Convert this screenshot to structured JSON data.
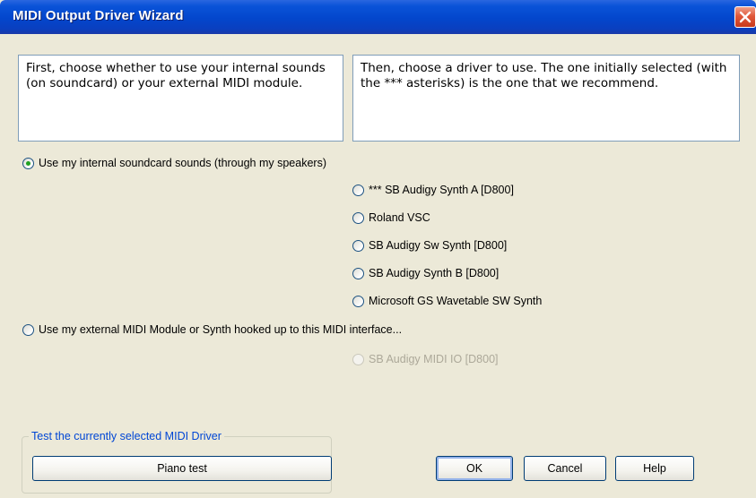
{
  "window": {
    "title": "MIDI Output Driver Wizard"
  },
  "instructions": {
    "left": "First, choose whether to use your internal sounds (on soundcard) or your external MIDI module.",
    "right": "Then, choose a driver to use. The one initially selected (with the *** asterisks) is the one that we recommend."
  },
  "options": {
    "internal_label": "Use my internal soundcard sounds (through my speakers)",
    "internal_checked": true,
    "internal_drivers": [
      "*** SB Audigy Synth A [D800]",
      "Roland VSC",
      "SB Audigy Sw Synth [D800]",
      "SB Audigy Synth B [D800]",
      "Microsoft GS Wavetable SW Synth"
    ],
    "external_label": "Use my external MIDI Module or Synth hooked up to this MIDI interface...",
    "external_checked": false,
    "external_drivers": [
      "SB Audigy MIDI IO [D800]"
    ]
  },
  "test_group": {
    "legend": "Test the currently selected MIDI Driver",
    "piano_label": "Piano test"
  },
  "buttons": {
    "ok": "OK",
    "cancel": "Cancel",
    "help": "Help"
  },
  "colors": {
    "titlebar": "#0346cc",
    "dialog_bg": "#ece9d8",
    "radio_check": "#21a121",
    "legend_text": "#0046d5"
  }
}
